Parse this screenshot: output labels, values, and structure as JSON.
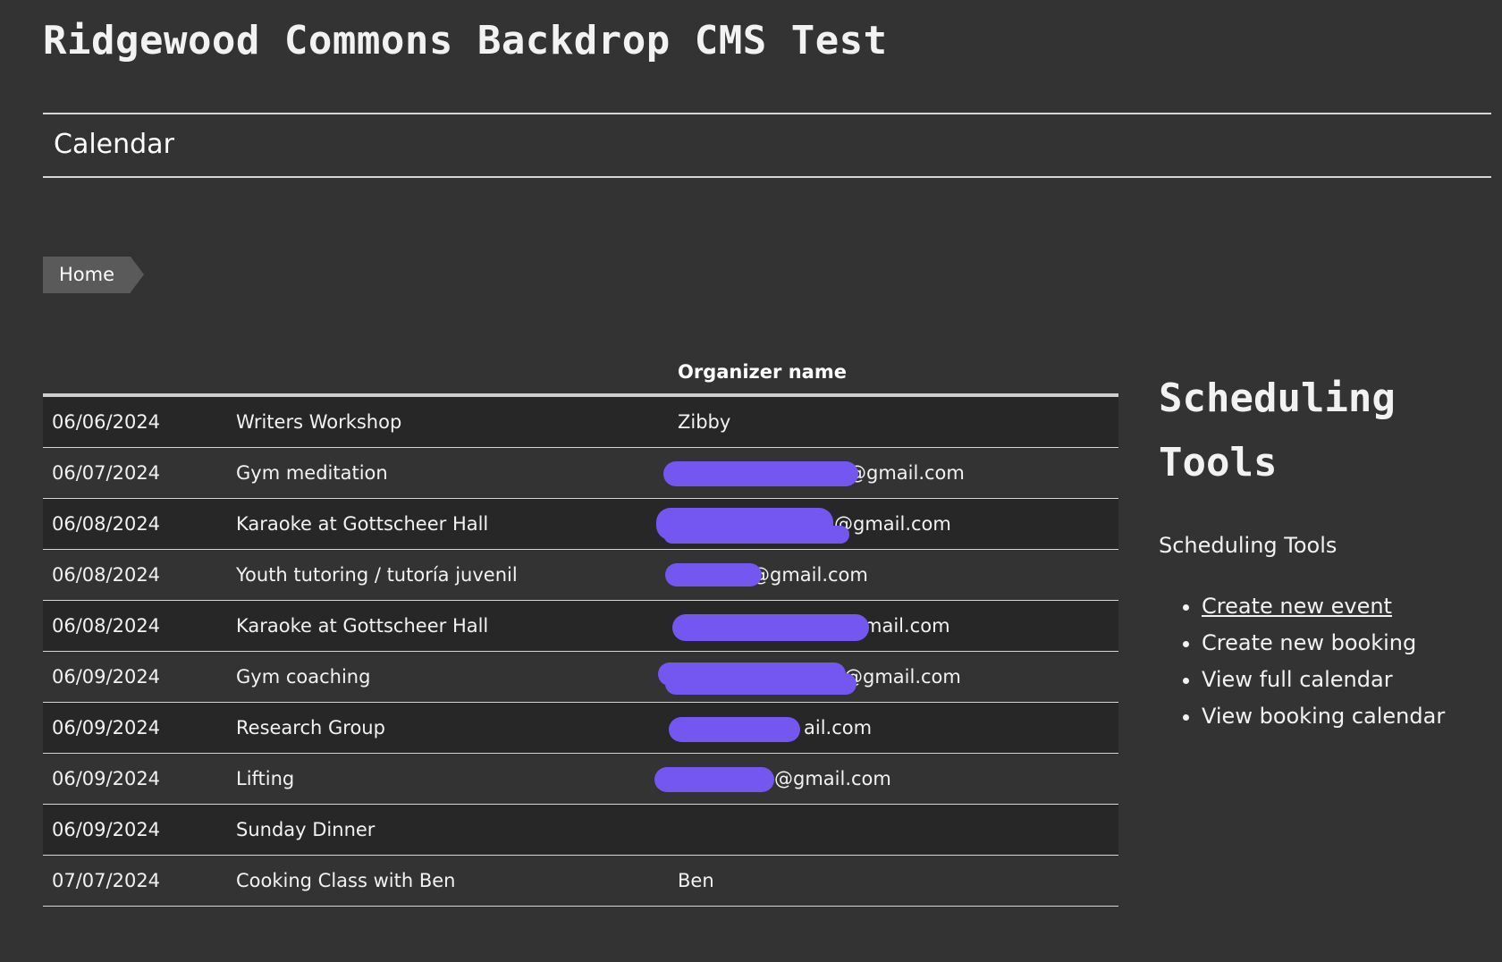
{
  "site": {
    "title": "Ridgewood Commons Backdrop CMS Test"
  },
  "menu": {
    "item": "Calendar"
  },
  "breadcrumb": {
    "home": "Home"
  },
  "table": {
    "headers": [
      "",
      "",
      "Organizer name"
    ],
    "rows": [
      {
        "date": "06/06/2024",
        "title": "Writers Workshop",
        "organizer": "Zibby"
      },
      {
        "date": "06/07/2024",
        "title": "Gym meditation",
        "organizer": "@gmail.com"
      },
      {
        "date": "06/08/2024",
        "title": "Karaoke at Gottscheer Hall",
        "organizer": "@gmail.com"
      },
      {
        "date": "06/08/2024",
        "title": "Youth tutoring / tutoría juvenil",
        "organizer": "@gmail.com"
      },
      {
        "date": "06/08/2024",
        "title": "Karaoke at Gottscheer Hall",
        "organizer": "mail.com"
      },
      {
        "date": "06/09/2024",
        "title": "Gym coaching",
        "organizer": "@gmail.com"
      },
      {
        "date": "06/09/2024",
        "title": "Research Group",
        "organizer": "ail.com"
      },
      {
        "date": "06/09/2024",
        "title": "Lifting",
        "organizer": "@gmail.com"
      },
      {
        "date": "06/09/2024",
        "title": "Sunday Dinner",
        "organizer": ""
      },
      {
        "date": "07/07/2024",
        "title": "Cooking Class with Ben",
        "organizer": "Ben"
      }
    ]
  },
  "sidebar": {
    "heading_line1": "Scheduling",
    "heading_line2": "Tools",
    "subtitle": "Scheduling Tools",
    "tools": [
      "Create new event",
      "Create new booking",
      "View full calendar",
      "View booking calendar"
    ]
  },
  "colors": {
    "background": "#333333",
    "row_dark": "#272727",
    "redaction": "#7457f0"
  }
}
